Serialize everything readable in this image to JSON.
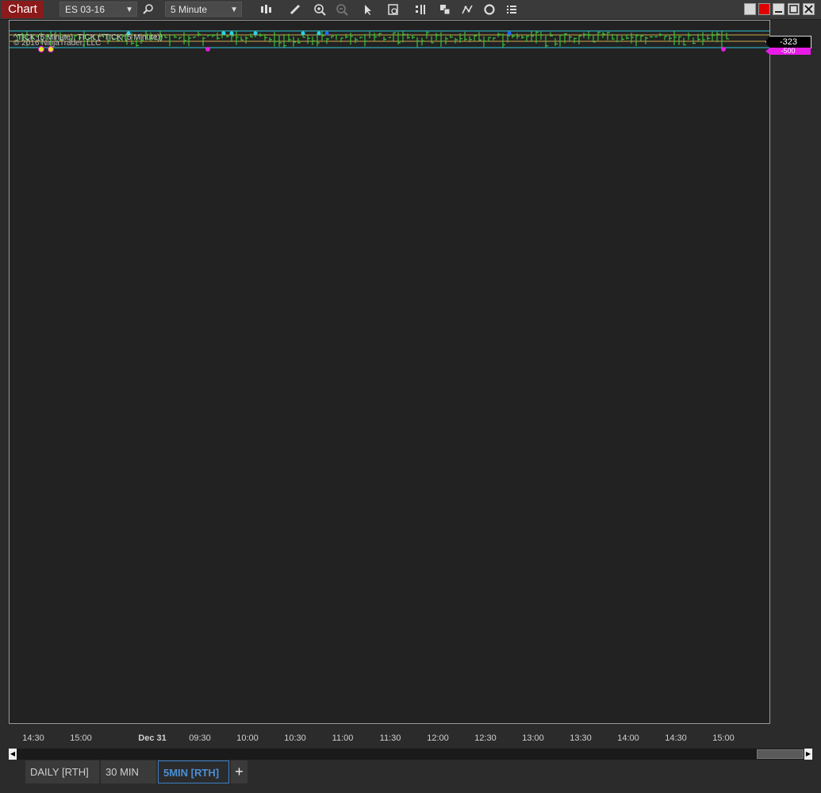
{
  "toolbar": {
    "chart_label": "Chart",
    "instrument": "ES 03-16",
    "interval": "5 Minute"
  },
  "chart": {
    "indicator_label": "^TICK (5 Minute), TICK (^TICK (5 Minute))",
    "copyright": "© 2016 NinjaTrader, LLC",
    "price_marker_black": "-323",
    "price_marker_magenta": "-500",
    "x_axis_labels": [
      "14:30",
      "15:00",
      "Dec 31",
      "09:30",
      "10:00",
      "10:30",
      "11:00",
      "11:30",
      "12:00",
      "12:30",
      "13:00",
      "13:30",
      "14:00",
      "14:30",
      "15:00"
    ]
  },
  "tabs": [
    {
      "label": "DAILY [RTH]"
    },
    {
      "label": "30 MIN"
    },
    {
      "label": "5MIN [RTH]"
    }
  ],
  "add_tab_label": "+",
  "colors": {
    "bar_up": "#39c23a",
    "upper_marker": "#29d6e6",
    "lower_marker": "#e01be0",
    "window_red": "#e00000",
    "chart_button": "#8b1a1a",
    "active_tab": "#3e7fc4"
  }
}
